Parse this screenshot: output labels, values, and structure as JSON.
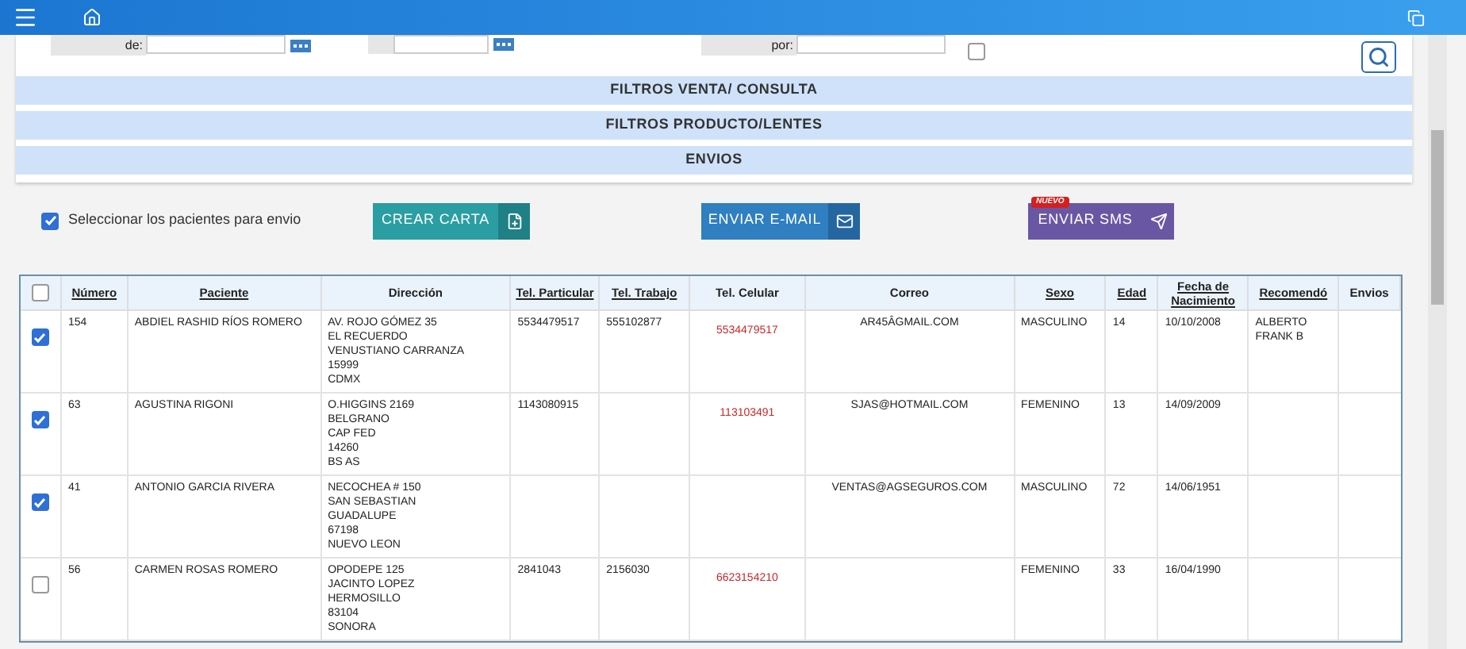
{
  "filters": {
    "date_from_label": "de:",
    "recommended_by_label": "por:",
    "include_checked": false
  },
  "sections": [
    {
      "label": "FILTROS VENTA/ CONSULTA"
    },
    {
      "label": "FILTROS PRODUCTO/LENTES"
    },
    {
      "label": "ENVIOS"
    }
  ],
  "select_all_patients": {
    "label": "Seleccionar los pacientes para envio",
    "checked": true
  },
  "actions": [
    {
      "kind": "letter",
      "label": "CREAR CARTA"
    },
    {
      "kind": "email",
      "label": "ENVIAR E-MAIL"
    },
    {
      "kind": "sms",
      "label": "ENVIAR SMS",
      "badge": "NUEVO"
    }
  ],
  "table": {
    "header_checked": false,
    "columns": [
      {
        "label": "Número",
        "sortable": true
      },
      {
        "label": "Paciente",
        "sortable": true
      },
      {
        "label": "Dirección",
        "sortable": false
      },
      {
        "label": "Tel. Particular",
        "sortable": true
      },
      {
        "label": "Tel. Trabajo",
        "sortable": true
      },
      {
        "label": "Tel. Celular",
        "sortable": false
      },
      {
        "label": "Correo",
        "sortable": false
      },
      {
        "label": "Sexo",
        "sortable": true
      },
      {
        "label": "Edad",
        "sortable": true
      },
      {
        "label": "Fecha de Nacimiento",
        "sortable": true
      },
      {
        "label": "Recomendó",
        "sortable": true
      },
      {
        "label": "Envios",
        "sortable": false
      }
    ],
    "rows": [
      {
        "checked": true,
        "number": "154",
        "patient": "ABDIEL RASHID RÍOS ROMERO",
        "address": [
          "AV. ROJO GÓMEZ 35",
          "EL RECUERDO",
          "VENUSTIANO CARRANZA",
          "15999",
          "CDMX"
        ],
        "home_phone": "5534479517",
        "work_phone": "555102877",
        "mobile": "5534479517",
        "email": "AR45ÂGMAIL.COM",
        "sex": "MASCULINO",
        "age": "14",
        "birth_date": "10/10/2008",
        "recommended_by": "ALBERTO FRANK B"
      },
      {
        "checked": true,
        "number": "63",
        "patient": "AGUSTINA RIGONI",
        "address": [
          "O.HIGGINS 2169",
          "BELGRANO",
          "CAP FED",
          "14260",
          "BS AS"
        ],
        "home_phone": "1143080915",
        "work_phone": "",
        "mobile": "113103491",
        "email": "SJAS@HOTMAIL.COM",
        "sex": "FEMENINO",
        "age": "13",
        "birth_date": "14/09/2009",
        "recommended_by": ""
      },
      {
        "checked": true,
        "number": "41",
        "patient": "ANTONIO GARCIA RIVERA",
        "address": [
          "NECOCHEA # 150",
          "SAN SEBASTIAN",
          "GUADALUPE",
          "67198",
          "NUEVO LEON"
        ],
        "home_phone": "",
        "work_phone": "",
        "mobile": "",
        "email": "VENTAS@AGSEGUROS.COM",
        "sex": "MASCULINO",
        "age": "72",
        "birth_date": "14/06/1951",
        "recommended_by": ""
      },
      {
        "checked": false,
        "number": "56",
        "patient": "CARMEN ROSAS ROMERO",
        "address": [
          "OPODEPE 125",
          "JACINTO LOPEZ",
          "HERMOSILLO",
          "83104",
          "SONORA"
        ],
        "home_phone": "2841043",
        "work_phone": "2156030",
        "mobile": "6623154210",
        "email": "",
        "sex": "FEMENINO",
        "age": "33",
        "birth_date": "16/04/1990",
        "recommended_by": ""
      }
    ]
  }
}
